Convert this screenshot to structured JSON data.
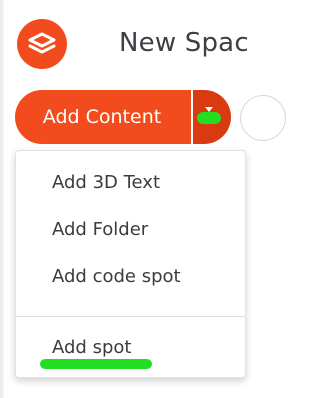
{
  "header": {
    "title": "New Spac"
  },
  "toolbar": {
    "add_content_label": "Add Content",
    "dropdown_icon": "caret-down-icon"
  },
  "menu": {
    "items": [
      {
        "label": "Add 3D Text"
      },
      {
        "label": "Add Folder"
      },
      {
        "label": "Add code spot"
      },
      {
        "label": "Add spot"
      }
    ]
  },
  "colors": {
    "accent": "#f24b1d",
    "accent_dark": "#d93a10",
    "highlight": "#22dd22"
  },
  "icons": {
    "logo": "layers-logo-icon"
  }
}
